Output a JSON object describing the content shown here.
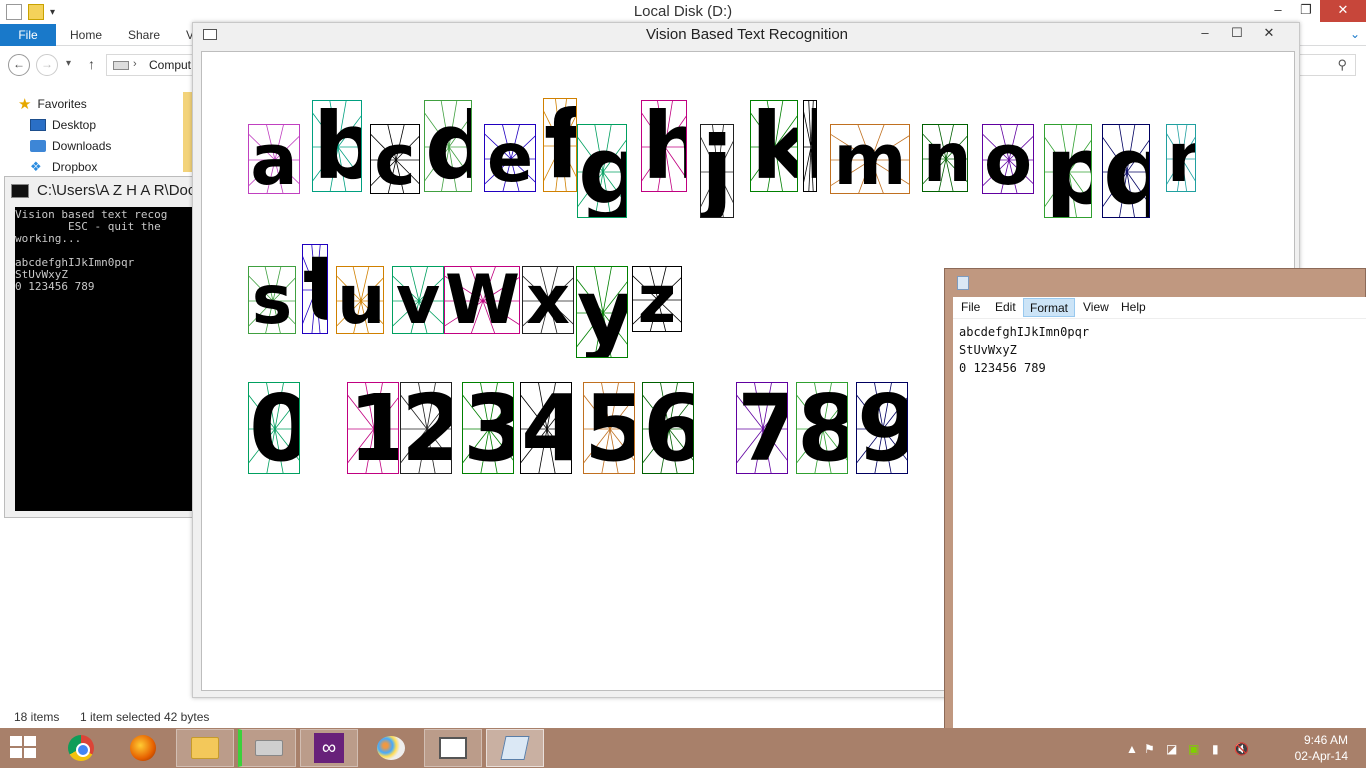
{
  "explorer": {
    "title": "Local Disk (D:)",
    "ribbon_tabs": [
      "File",
      "Home",
      "Share",
      "V"
    ],
    "address_text": "Comput",
    "nav": {
      "favorites": "Favorites",
      "items": [
        "Desktop",
        "Downloads",
        "Dropbox"
      ]
    },
    "status": {
      "count": "18 items",
      "selected": "1 item selected",
      "size": "42 bytes"
    }
  },
  "console": {
    "title": "C:\\Users\\A Z H A R\\Doc",
    "lines": "Vision based text recog\n        ESC - quit the\nworking...\n\nabcdefghIJkImn0pqr\nStUvWxyZ\n0 123456 789"
  },
  "vision": {
    "title": "Vision Based Text Recognition",
    "row1": [
      "a",
      "b",
      "c",
      "d",
      "e",
      "f",
      "g",
      "h",
      "j",
      "k",
      "l",
      "m",
      "n",
      "o",
      "p",
      "q",
      "r"
    ],
    "row2": [
      "s",
      "t",
      "u",
      "v",
      "W",
      "x",
      "y",
      "z"
    ],
    "row3": [
      "0",
      "1",
      "2",
      "3",
      "4",
      "5",
      "6",
      "7",
      "8",
      "9"
    ],
    "box_colors": [
      "#c040c0",
      "#00a080",
      "#000000",
      "#40a040",
      "#2000c0",
      "#d08000",
      "#00a060",
      "#c00080",
      "#202020",
      "#008000",
      "#000000",
      "#c07020",
      "#006000",
      "#6000a0",
      "#30a030",
      "#000060",
      "#20a0a0"
    ]
  },
  "notepad": {
    "menu": [
      "File",
      "Edit",
      "Format",
      "View",
      "Help"
    ],
    "active_menu": "Format",
    "content": "abcdefghIJkImn0pqr\nStUvWxyZ\n0 123456 789"
  },
  "taskbar": {
    "apps": [
      "start-icon",
      "chrome-icon",
      "firefox-icon",
      "file-explorer-icon",
      "drive-icon",
      "visual-studio-icon",
      "paint-icon",
      "vision-app-icon",
      "notepad-icon"
    ],
    "time": "9:46 AM",
    "date": "02-Apr-14"
  }
}
